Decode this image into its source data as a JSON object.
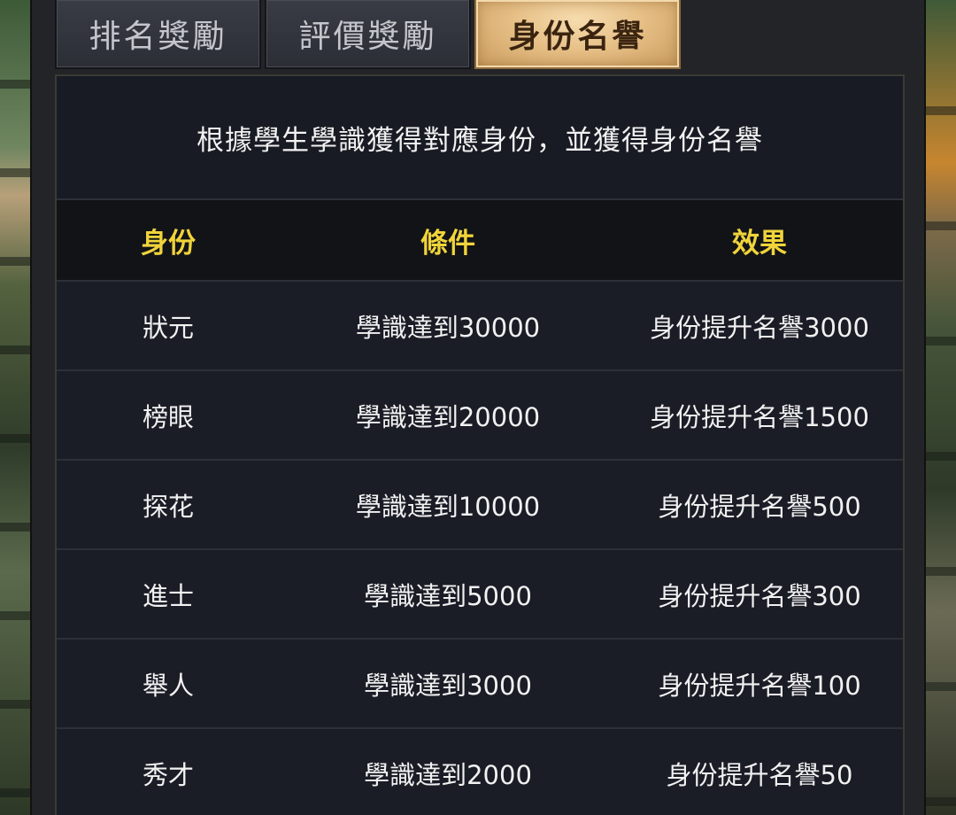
{
  "tabs": [
    {
      "label": "排名獎勵",
      "active": false
    },
    {
      "label": "評價獎勵",
      "active": false
    },
    {
      "label": "身份名譽",
      "active": true
    }
  ],
  "description": "根據學生學識獲得對應身份，並獲得身份名譽",
  "table": {
    "headers": [
      "身份",
      "條件",
      "效果"
    ],
    "rows": [
      {
        "identity": "狀元",
        "condition": "學識達到30000",
        "effect": "身份提升名譽3000"
      },
      {
        "identity": "榜眼",
        "condition": "學識達到20000",
        "effect": "身份提升名譽1500"
      },
      {
        "identity": "探花",
        "condition": "學識達到10000",
        "effect": "身份提升名譽500"
      },
      {
        "identity": "進士",
        "condition": "學識達到5000",
        "effect": "身份提升名譽300"
      },
      {
        "identity": "舉人",
        "condition": "學識達到3000",
        "effect": "身份提升名譽100"
      },
      {
        "identity": "秀才",
        "condition": "學識達到2000",
        "effect": "身份提升名譽50"
      }
    ]
  },
  "colors": {
    "header_text": "#f0d43a",
    "active_tab": "#e6bf86",
    "panel_bg": "#191b24"
  }
}
